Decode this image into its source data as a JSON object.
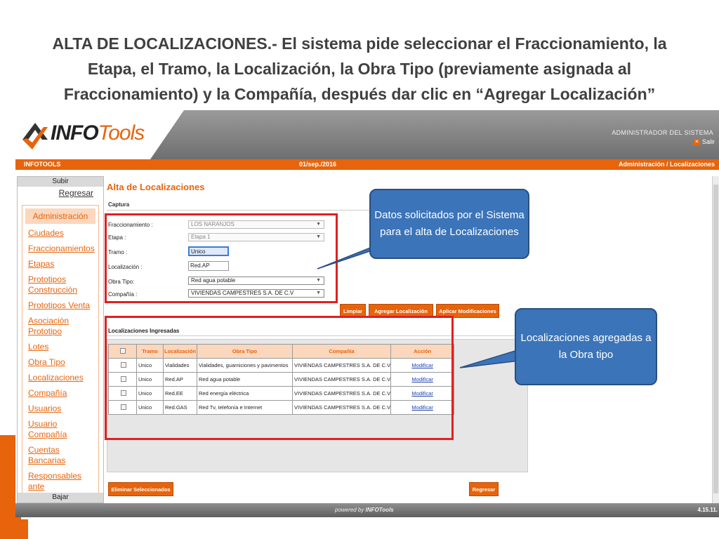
{
  "slide": {
    "title": "ALTA DE LOCALIZACIONES.- El sistema pide seleccionar el Fraccionamiento, la Etapa, el Tramo, la Localización, la Obra Tipo (previamente asignada al Fraccionamiento) y la Compañía, después dar clic en “Agregar Localización”"
  },
  "header": {
    "logo_info": "INFO",
    "logo_tools": "Tools",
    "user_role": "ADMINISTRADOR DEL SISTEMA",
    "logout_label": "Salir",
    "brand_color": "#e8640c"
  },
  "topbar": {
    "app_name": "INFOTOOLS",
    "date": "01/sep./2016",
    "breadcrumb": "Administración / Localizaciones"
  },
  "sidebar": {
    "up_label": "Subir",
    "back_label": "Regresar",
    "menu_title": "Administración",
    "items": [
      "Ciudades",
      "Fraccionamientos",
      "Etapas",
      "Prototipos Construcción",
      "Prototipos Venta",
      "Asociación Prototipo",
      "Lotes",
      "Obra Tipo",
      "Localizaciones",
      "Compañía",
      "Usuarios",
      "Usuario Compañía",
      "Cuentas Bancarias",
      "Responsables ante"
    ],
    "down_label": "Bajar"
  },
  "main": {
    "title": "Alta de Localizaciones",
    "section_capture": "Captura",
    "form": {
      "fraccionamiento_label": "Fraccionamiento :",
      "fraccionamiento_value": "LOS NARANJOS",
      "etapa_label": "Etapa :",
      "etapa_value": "Etapa 1",
      "tramo_label": "Tramo :",
      "tramo_value": "Unico",
      "localizacion_label": "Localización :",
      "localizacion_value": "Red.AP",
      "obra_tipo_label": "Obra Tipo:",
      "obra_tipo_value": "Red agua potable",
      "compania_label": "Compañía :",
      "compania_value": "VIVIENDAS CAMPESTRES S.A. DE C.V"
    },
    "buttons": {
      "clear": "Limpiar",
      "add": "Agregar Localización",
      "apply": "Aplicar Modificaciones",
      "delete_selected": "Eliminar Seleccionados",
      "back": "Regresar"
    },
    "section_entered": "Localizaciones Ingresadas",
    "table": {
      "headers": [
        "",
        "Tramo",
        "Localización",
        "Obra Tipo",
        "Compañía",
        "Acción"
      ],
      "rows": [
        [
          "Unico",
          "Vialidades",
          "Vialidades, guarniciones y pavimentos",
          "VIVIENDAS CAMPESTRES S.A. DE C.V",
          "Modificar"
        ],
        [
          "Unico",
          "Red.AP",
          "Red agua potable",
          "VIVIENDAS CAMPESTRES S.A. DE C.V",
          "Modificar"
        ],
        [
          "Unico",
          "Red.EE",
          "Red energía eléctrica",
          "VIVIENDAS CAMPESTRES S.A. DE C.V",
          "Modificar"
        ],
        [
          "Unico",
          "Red.GAS",
          "Red Tv, telefonía e Internet",
          "VIVIENDAS CAMPESTRES S.A. DE C.V",
          "Modificar"
        ]
      ]
    }
  },
  "footer": {
    "powered_by": "powered by",
    "powered_brand": "INFOTools",
    "version": "4.15.11."
  },
  "callouts": {
    "form_note": "Datos solicitados por el Sistema para el alta de Localizaciones",
    "table_note": "Localizaciones agregadas a la Obra tipo"
  }
}
